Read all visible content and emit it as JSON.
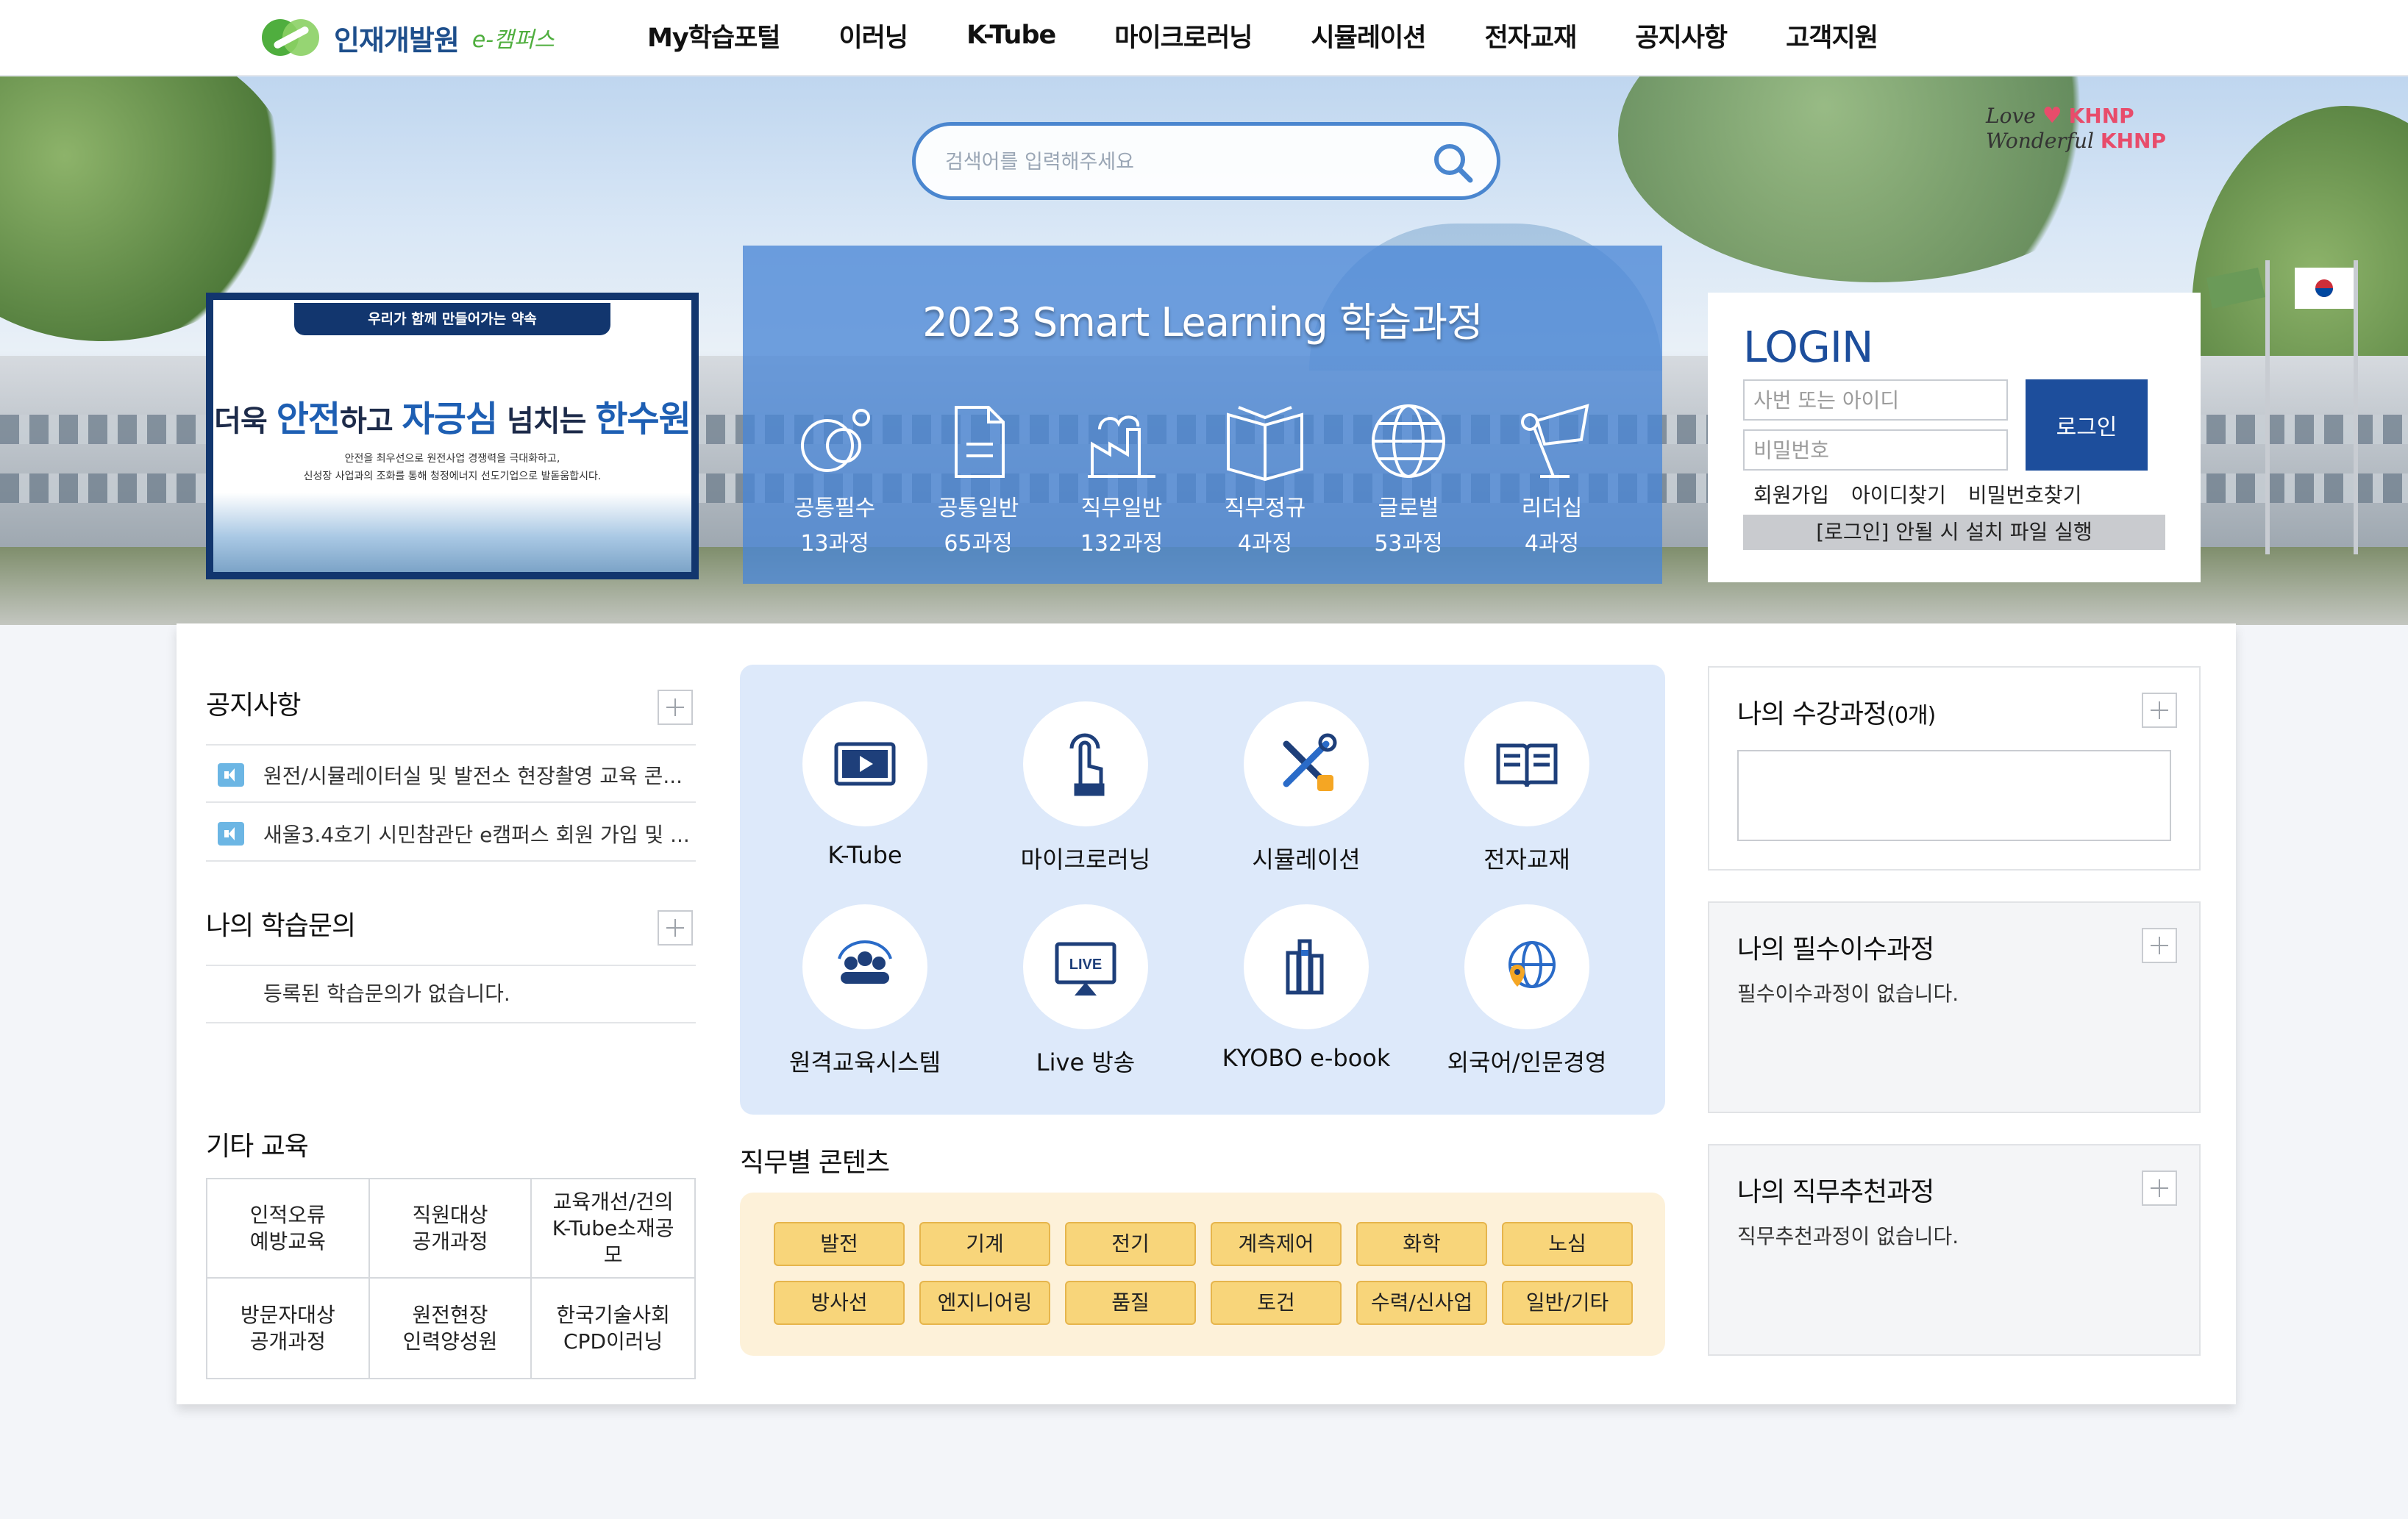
{
  "header": {
    "logo_name": "인재개발원",
    "logo_sub": "e-캠퍼스",
    "nav": [
      "My학습포털",
      "이러닝",
      "K-Tube",
      "마이크로러닝",
      "시뮬레이션",
      "전자교재",
      "공지사항",
      "고객지원"
    ]
  },
  "hero": {
    "search_placeholder": "검색어를 입력해주세요",
    "slogan_line1_word": "Love",
    "slogan_line2_word": "Wonderful",
    "slogan_brand": "KHNP",
    "banner": {
      "top": "우리가 함께 만들어가는 약속",
      "main_pre": "더욱",
      "main_hl1": "안전",
      "main_mid1": "하고",
      "main_hl2": "자긍심",
      "main_mid2": "넘치는",
      "main_hl3": "한수원",
      "sub1": "안전을 최우선으로 원전사업 경쟁력을 극대화하고,",
      "sub2": "신성장 사업과의 조화를 통해 청정에너지 선도기업으로 발돋움합시다."
    },
    "course_panel": {
      "title": "2023 Smart Learning 학습과정",
      "categories": [
        {
          "name": "공통필수",
          "count": "13과정"
        },
        {
          "name": "공통일반",
          "count": "65과정"
        },
        {
          "name": "직무일반",
          "count": "132과정"
        },
        {
          "name": "직무정규",
          "count": "4과정"
        },
        {
          "name": "글로벌",
          "count": "53과정"
        },
        {
          "name": "리더십",
          "count": "4과정"
        }
      ]
    },
    "login": {
      "title": "LOGIN",
      "id_placeholder": "사번 또는 아이디",
      "pw_placeholder": "비밀번호",
      "button": "로그인",
      "links": [
        "회원가입",
        "아이디찾기",
        "비밀번호찾기"
      ],
      "install_note": "[로그인] 안될 시 설치 파일 실행"
    }
  },
  "left": {
    "notice_title": "공지사항",
    "notices": [
      "원전/시뮬레이터실 및 발전소 현장촬영 교육 콘...",
      "새울3.4호기 시민참관단 e캠퍼스 회원 가입 및 ..."
    ],
    "inquiry_title": "나의 학습문의",
    "inquiry_empty": "등록된 학습문의가 없습니다.",
    "etc_title": "기타 교육",
    "etc_items": [
      [
        "인적오류",
        "예방교육"
      ],
      [
        "직원대상",
        "공개과정"
      ],
      [
        "교육개선/건의",
        "K-Tube소재공",
        "모"
      ],
      [
        "방문자대상",
        "공개과정"
      ],
      [
        "원전현장",
        "인력양성원"
      ],
      [
        "한국기술사회",
        "CPD이러닝"
      ]
    ]
  },
  "center": {
    "quick_links": [
      "K-Tube",
      "마이크로러닝",
      "시뮬레이션",
      "전자교재",
      "원격교육시스템",
      "Live 방송",
      "KYOBO e-book",
      "외국어/인문경영"
    ],
    "live_badge": "LIVE",
    "job_title": "직무별 콘텐츠",
    "job_tags": [
      "발전",
      "기계",
      "전기",
      "계측제어",
      "화학",
      "노심",
      "방사선",
      "엔지니어링",
      "품질",
      "토건",
      "수력/신사업",
      "일반/기타"
    ]
  },
  "right": {
    "my_courses_title": "나의 수강과정",
    "my_courses_count": "(0개)",
    "required_title": "나의 필수이수과정",
    "required_empty": "필수이수과정이 없습니다.",
    "recommend_title": "나의 직무추천과정",
    "recommend_empty": "직무추천과정이 없습니다."
  },
  "colors": {
    "primary_blue": "#1d4e9c",
    "course_panel": "#4a86d6",
    "quick_panel_bg": "#dde9fa",
    "job_panel_bg": "#fdf1d9",
    "job_tag": "#f8d57a"
  }
}
